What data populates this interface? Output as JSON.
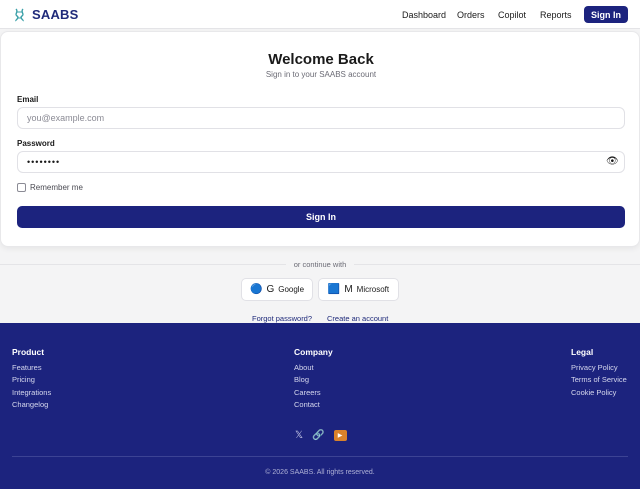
{
  "header": {
    "brand": "SAABS",
    "nav": [
      "Dashboard",
      "Orders",
      "Copilot",
      "Reports"
    ],
    "signin_label": "Sign In"
  },
  "login": {
    "title": "Welcome Back",
    "subtitle": "Sign in to your SAABS account",
    "email_label": "Email",
    "email_placeholder": "you@example.com",
    "email_value": "",
    "password_label": "Password",
    "password_value": "••••••••",
    "remember_label": "Remember me",
    "remember_checked": false,
    "submit_label": "Sign In"
  },
  "alt": {
    "divider": "or continue with",
    "google_glyph": "G",
    "google_label": "Google",
    "microsoft_glyph": "M",
    "microsoft_label": "Microsoft",
    "forgot": "Forgot password?",
    "create": "Create an account"
  },
  "footer": {
    "product": {
      "heading": "Product",
      "links": [
        "Features",
        "Pricing",
        "Integrations",
        "Changelog"
      ]
    },
    "company": {
      "heading": "Company",
      "links": [
        "About",
        "Blog",
        "Careers",
        "Contact"
      ]
    },
    "legal": {
      "heading": "Legal",
      "links": [
        "Privacy Policy",
        "Terms of Service",
        "Cookie Policy"
      ]
    },
    "social_icons": [
      "x-icon",
      "link-icon",
      "youtube-icon"
    ],
    "copyright": "© 2026 SAABS. All rights reserved."
  },
  "colors": {
    "brand": "#1c237e",
    "background": "#f4f4f5",
    "card": "#ffffff"
  }
}
